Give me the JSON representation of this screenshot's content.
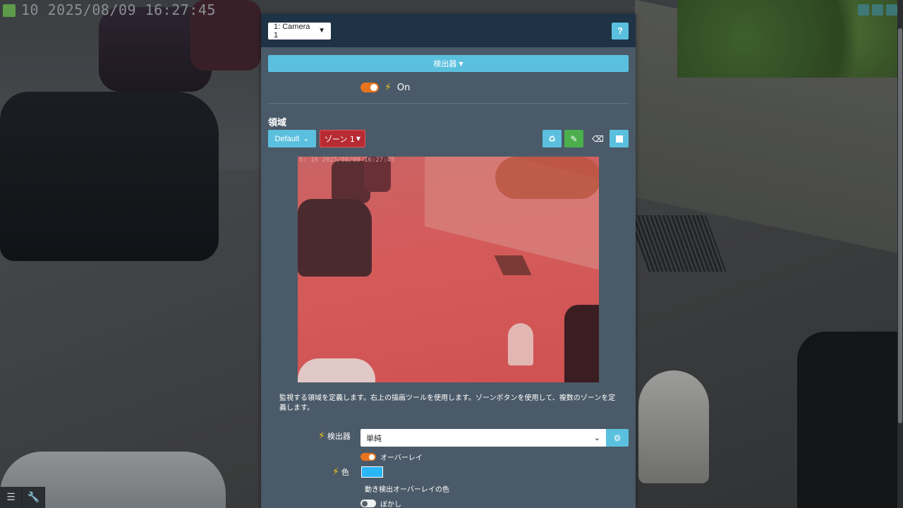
{
  "feed": {
    "timestamp": "10 2025/08/09 16:27:45",
    "preview_timestamp": "5: 10 2025/08/09 16:27:45"
  },
  "header": {
    "camera_select": "1: Camera 1",
    "help_label": "?"
  },
  "detector_menu": {
    "label": "検出器"
  },
  "power": {
    "state_label": "On",
    "enabled": true
  },
  "region": {
    "title": "領域",
    "default_label": "Default",
    "zone_label": "ゾーン 1",
    "help_text": "監視する領域を定義します。右上の描画ツールを使用します。ゾーンボタンを使用して、複数のゾーンを定義します。"
  },
  "form": {
    "detector_label": "検出器",
    "detector_value": "単純",
    "overlay_label": "オーバーレイ",
    "overlay_enabled": true,
    "color_label": "色",
    "color_value": "#29b6f6",
    "color_desc": "動き検出オーバーレイの色",
    "blur_label": "ぼかし",
    "blur_enabled": false
  },
  "colors": {
    "accent": "#5bc0de",
    "panel_header": "#1f3347",
    "panel_body": "#4b5a68",
    "zone": "#b72b33",
    "toggle_on": "#e8731e",
    "brush_tool": "#4cae4c"
  },
  "icons": {
    "power": "bolt-icon",
    "recycle": "recycle-icon",
    "brush": "brush-icon",
    "eraser": "eraser-icon",
    "fill": "square-icon",
    "gear": "gears-icon",
    "settings": "sliders-icon",
    "wrench": "wrench-icon"
  }
}
